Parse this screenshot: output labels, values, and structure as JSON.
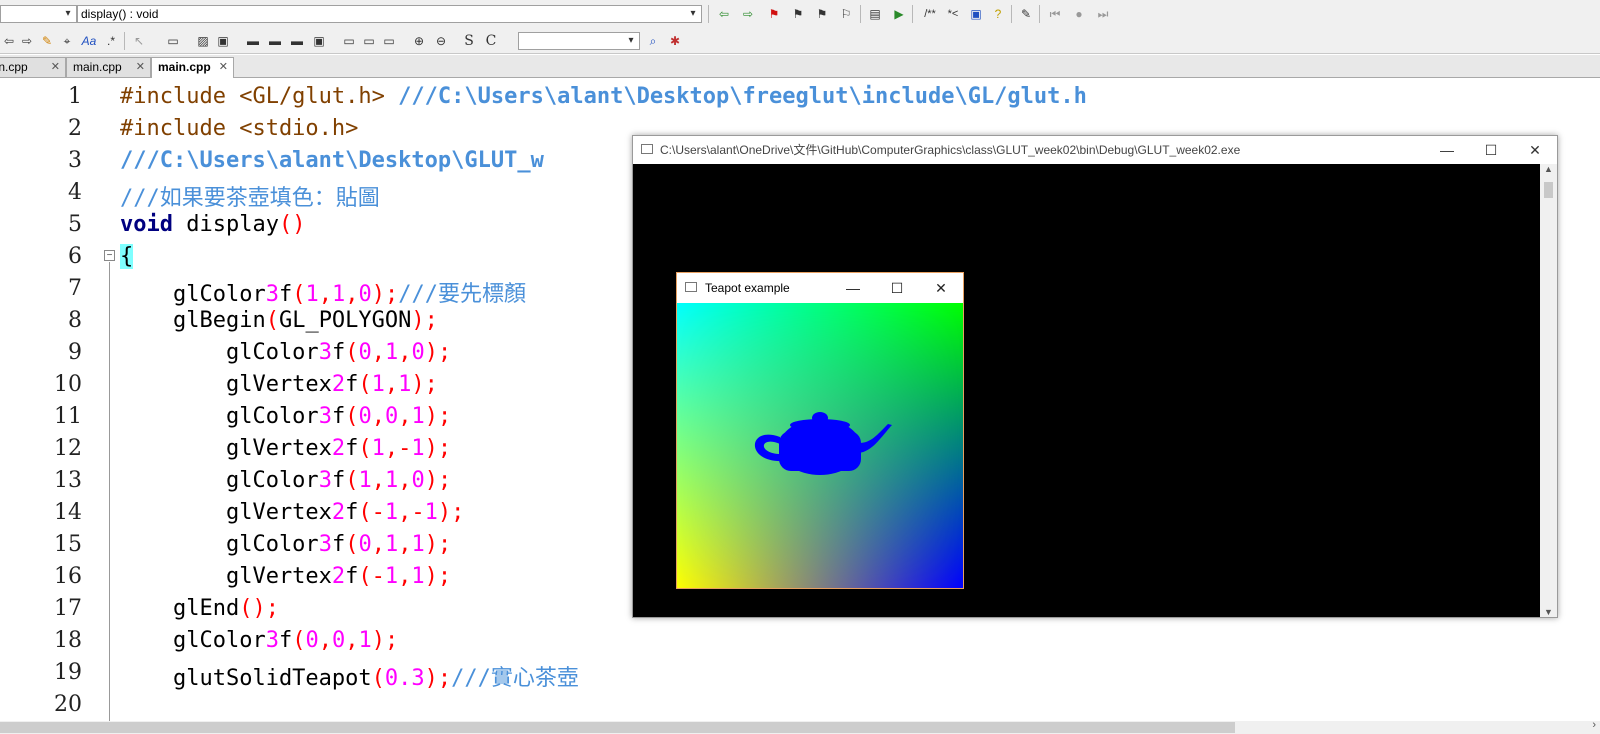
{
  "toolbar": {
    "scope_dropdown": "",
    "function_dropdown": "display() : void",
    "search_dropdown": "",
    "comment_buttons": [
      "/**",
      "*<"
    ]
  },
  "tabs": [
    {
      "label": "main.cpp",
      "active": false
    },
    {
      "label": "main.cpp",
      "active": false
    },
    {
      "label": "main.cpp",
      "active": true
    }
  ],
  "editor": {
    "line_numbers": [
      "1",
      "2",
      "3",
      "4",
      "5",
      "6",
      "7",
      "8",
      "9",
      "10",
      "11",
      "12",
      "13",
      "14",
      "15",
      "16",
      "17",
      "18",
      "19",
      "20"
    ],
    "lines": [
      "#include <GL/glut.h> ///C:\\Users\\alant\\Desktop\\freeglut\\include\\GL/glut.h",
      "#include <stdio.h>",
      "///C:\\Users\\alant\\Desktop\\GLUT_w",
      "///如果要茶壺填色：貼圖",
      "void display()",
      "{",
      "    glColor3f(1,1,0);///要先標顏",
      "    glBegin(GL_POLYGON);",
      "        glColor3f(0,1,0);",
      "        glVertex2f(1,1);",
      "        glColor3f(0,0,1);",
      "        glVertex2f(1,-1);",
      "        glColor3f(1,1,0);",
      "        glVertex2f(-1,-1);",
      "        glColor3f(0,1,1);",
      "        glVertex2f(-1,1);",
      "    glEnd();",
      "    glColor3f(0,0,1);",
      "    glutSolidTeapot(0.3);///實心茶壺",
      ""
    ]
  },
  "console_window": {
    "title": "C:\\Users\\alant\\OneDrive\\文件\\GitHub\\ComputerGraphics\\class\\GLUT_week02\\bin\\Debug\\GLUT_week02.exe",
    "minimize": "—",
    "maximize": "☐",
    "close": "✕"
  },
  "teapot_window": {
    "title": "Teapot example",
    "minimize": "—",
    "maximize": "☐",
    "close": "✕",
    "gradient_colors": {
      "top_left": "#00ffff",
      "top_right": "#00ff00",
      "bottom_left": "#ffff00",
      "bottom_right": "#0000ff"
    },
    "teapot_color": "#0000ff"
  }
}
